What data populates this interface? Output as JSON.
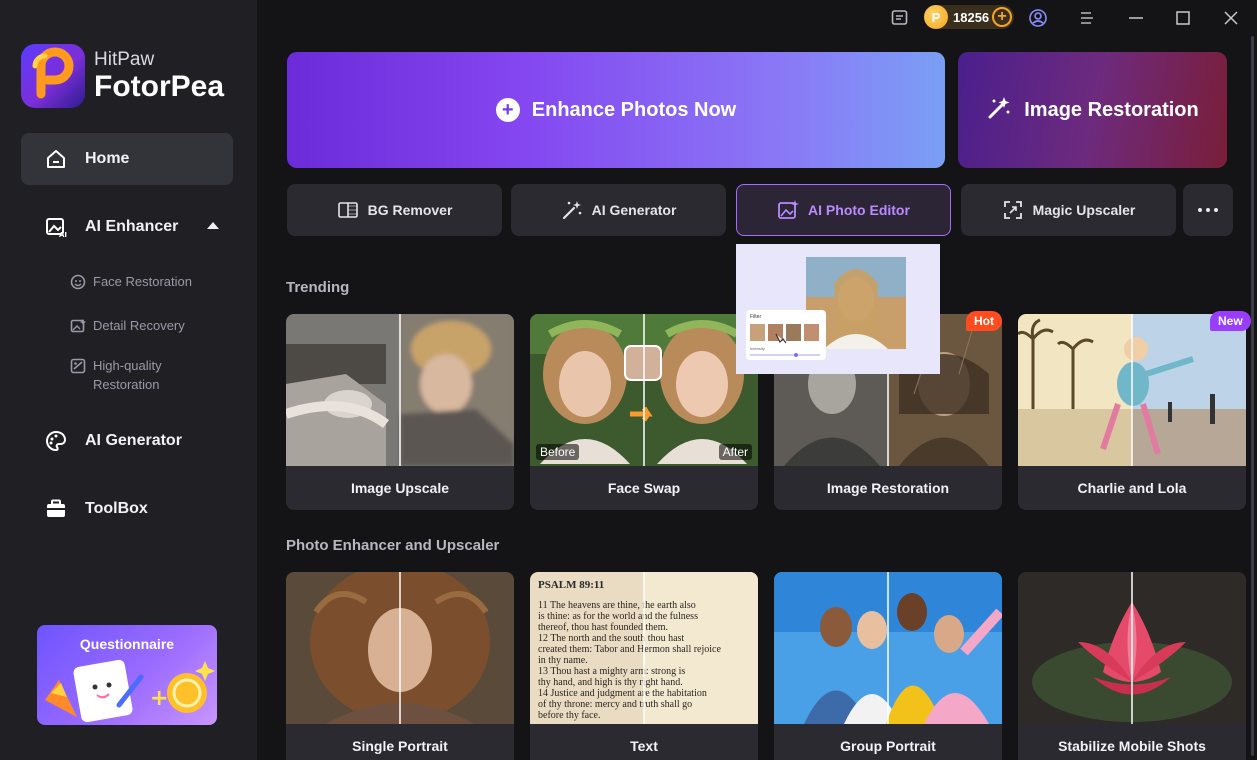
{
  "app": {
    "brand_small": "HitPaw",
    "brand_large": "FotorPea"
  },
  "titlebar": {
    "coins": "18256",
    "coin_symbol": "P"
  },
  "sidebar": {
    "home": "Home",
    "ai_enhancer": "AI Enhancer",
    "sub_items": [
      "Face Restoration",
      "Detail Recovery",
      "High-quality Restoration"
    ],
    "ai_generator": "AI Generator",
    "toolbox": "ToolBox",
    "questionnaire": "Questionnaire"
  },
  "hero": {
    "enhance": "Enhance Photos Now",
    "restoration": "Image Restoration"
  },
  "tools": [
    "BG Remover",
    "AI Generator",
    "AI Photo Editor",
    "Magic Upscaler"
  ],
  "preview": {
    "filter_label": "Filter",
    "intensity_label": "Intensity"
  },
  "sections": {
    "trending": "Trending",
    "photo_enhancer": "Photo Enhancer and Upscaler"
  },
  "trending_cards": [
    {
      "label": "Image Upscale"
    },
    {
      "label": "Face Swap",
      "before": "Before",
      "after": "After"
    },
    {
      "label": "Image Restoration",
      "badge": "Hot"
    },
    {
      "label": "Charlie and Lola",
      "badge": "New"
    }
  ],
  "enhancer_cards": [
    {
      "label": "Single Portrait"
    },
    {
      "label": "Text",
      "psalm": "PSALM 89:11",
      "lines": [
        "11 The heavens are thine, the earth also",
        "is thine: as for the world and the fulness",
        "thereof, thou hast founded them.",
        "12 The north and the south thou hast",
        "created them: Tabor and Hermon shall rejoice",
        "in thy name.",
        "13 Thou hast a mighty arm: strong is",
        "thy hand, and high is thy right hand.",
        "14 Justice and judgment are the habitation",
        "of thy throne: mercy and truth shall go",
        "before thy face."
      ]
    },
    {
      "label": "Group Portrait"
    },
    {
      "label": "Stabilize Mobile Shots"
    }
  ],
  "colors": {
    "accent": "#a46bff",
    "hot": "#ff4d1f",
    "new": "#9b3dff",
    "coin": "#f4a52a"
  }
}
